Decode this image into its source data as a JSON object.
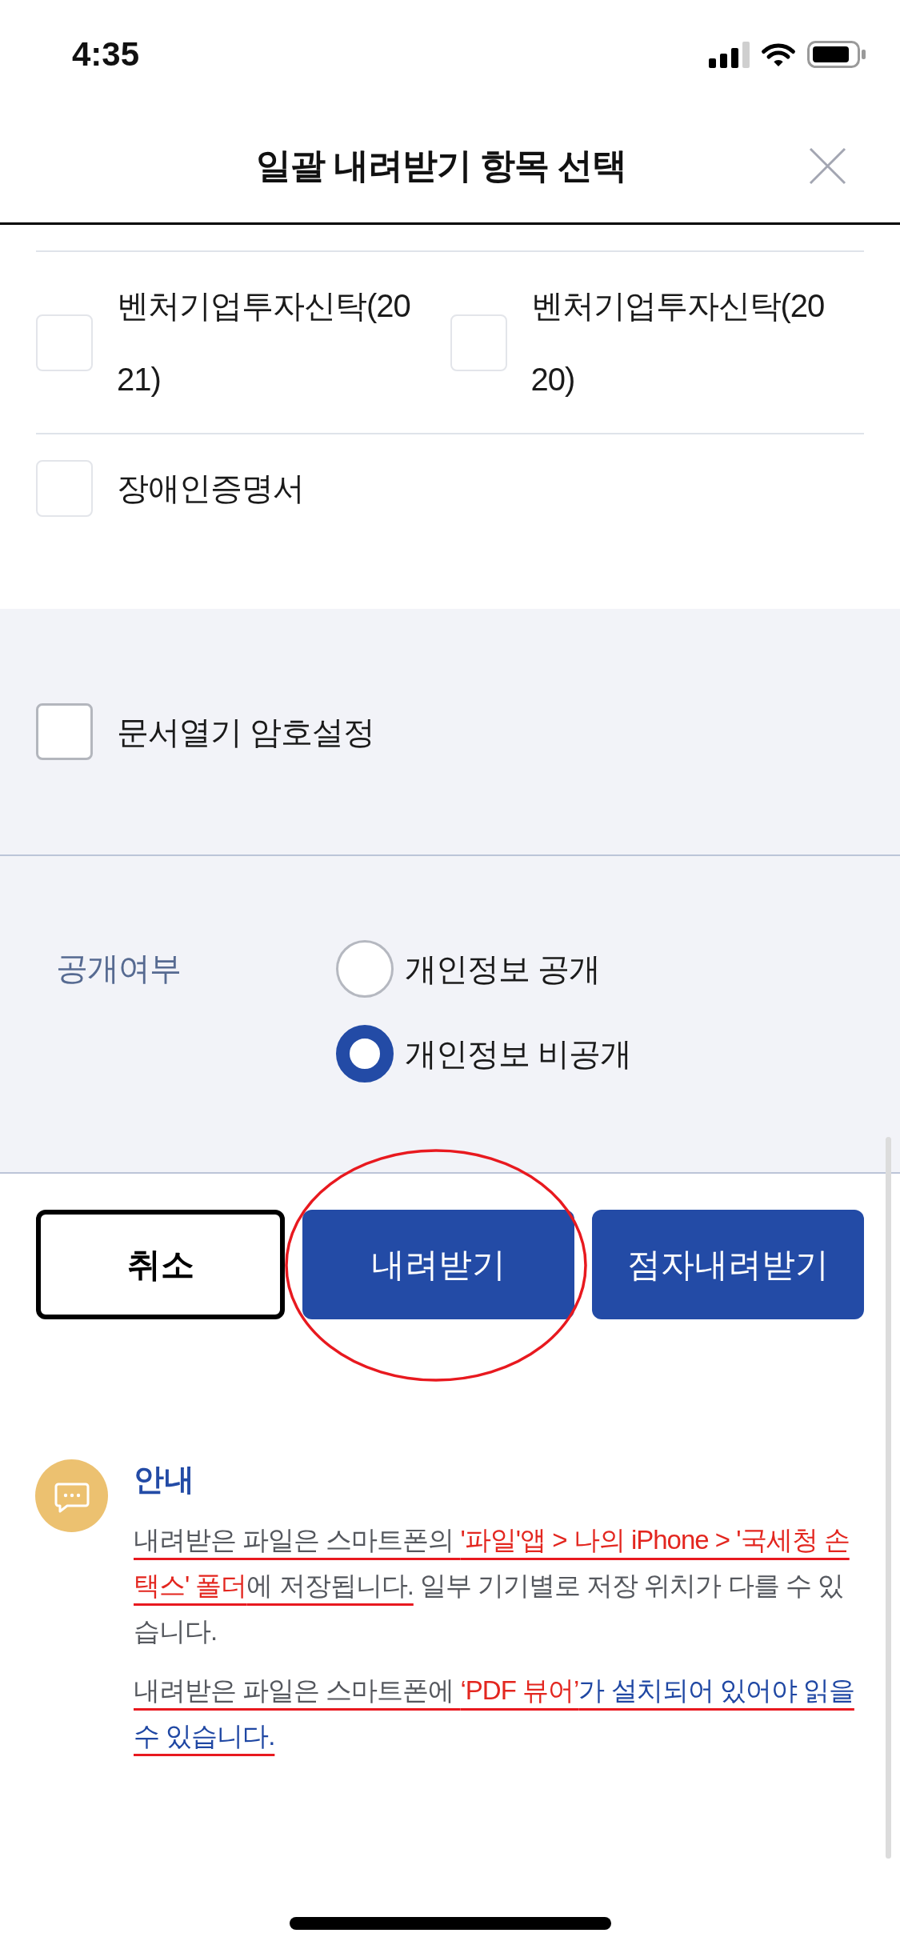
{
  "status_bar": {
    "time": "4:35"
  },
  "header": {
    "title": "일괄 내려받기 항목 선택"
  },
  "document_items": [
    {
      "label": "벤처기업투자신탁(2021)",
      "checked": false
    },
    {
      "label": "벤처기업투자신탁(2020)",
      "checked": false
    },
    {
      "label": "장애인증명서",
      "checked": false
    }
  ],
  "password_option": {
    "label": "문서열기 암호설정",
    "checked": false
  },
  "disclosure": {
    "label": "공개여부",
    "options": [
      {
        "label": "개인정보 공개",
        "selected": false
      },
      {
        "label": "개인정보 비공개",
        "selected": true
      }
    ]
  },
  "buttons": [
    {
      "label": "취소",
      "kind": "outline",
      "circled": false
    },
    {
      "label": "내려받기",
      "kind": "primary",
      "circled": true
    },
    {
      "label": "점자내려받기",
      "kind": "primary",
      "circled": false
    }
  ],
  "notice": {
    "title": "안내",
    "paragraphs": [
      {
        "segments": [
          {
            "text": "내려받은 파일은 스마트폰의 ",
            "color": "#55585e",
            "underlined": true
          },
          {
            "text": "'파일'앱 > 나의 iPhone > '국세청 손택스' 폴더",
            "color": "#e3261f",
            "underlined": true
          },
          {
            "text": "에 저장됩니다.",
            "color": "#55585e",
            "underlined": true
          },
          {
            "text": " 일부 기기별로 저장 위치가 다를 수 있습니다.",
            "color": "#55585e",
            "underlined": false
          }
        ]
      },
      {
        "segments": [
          {
            "text": "내려받은 파일은 스마트폰에 ",
            "color": "#55585e",
            "underlined": true
          },
          {
            "text": "‘PDF 뷰어’",
            "color": "#e3261f",
            "underlined": true
          },
          {
            "text": "가 설치되어 있어야 읽을 수 있습니다.",
            "color": "#1f47a3",
            "underlined": true
          }
        ]
      }
    ]
  }
}
